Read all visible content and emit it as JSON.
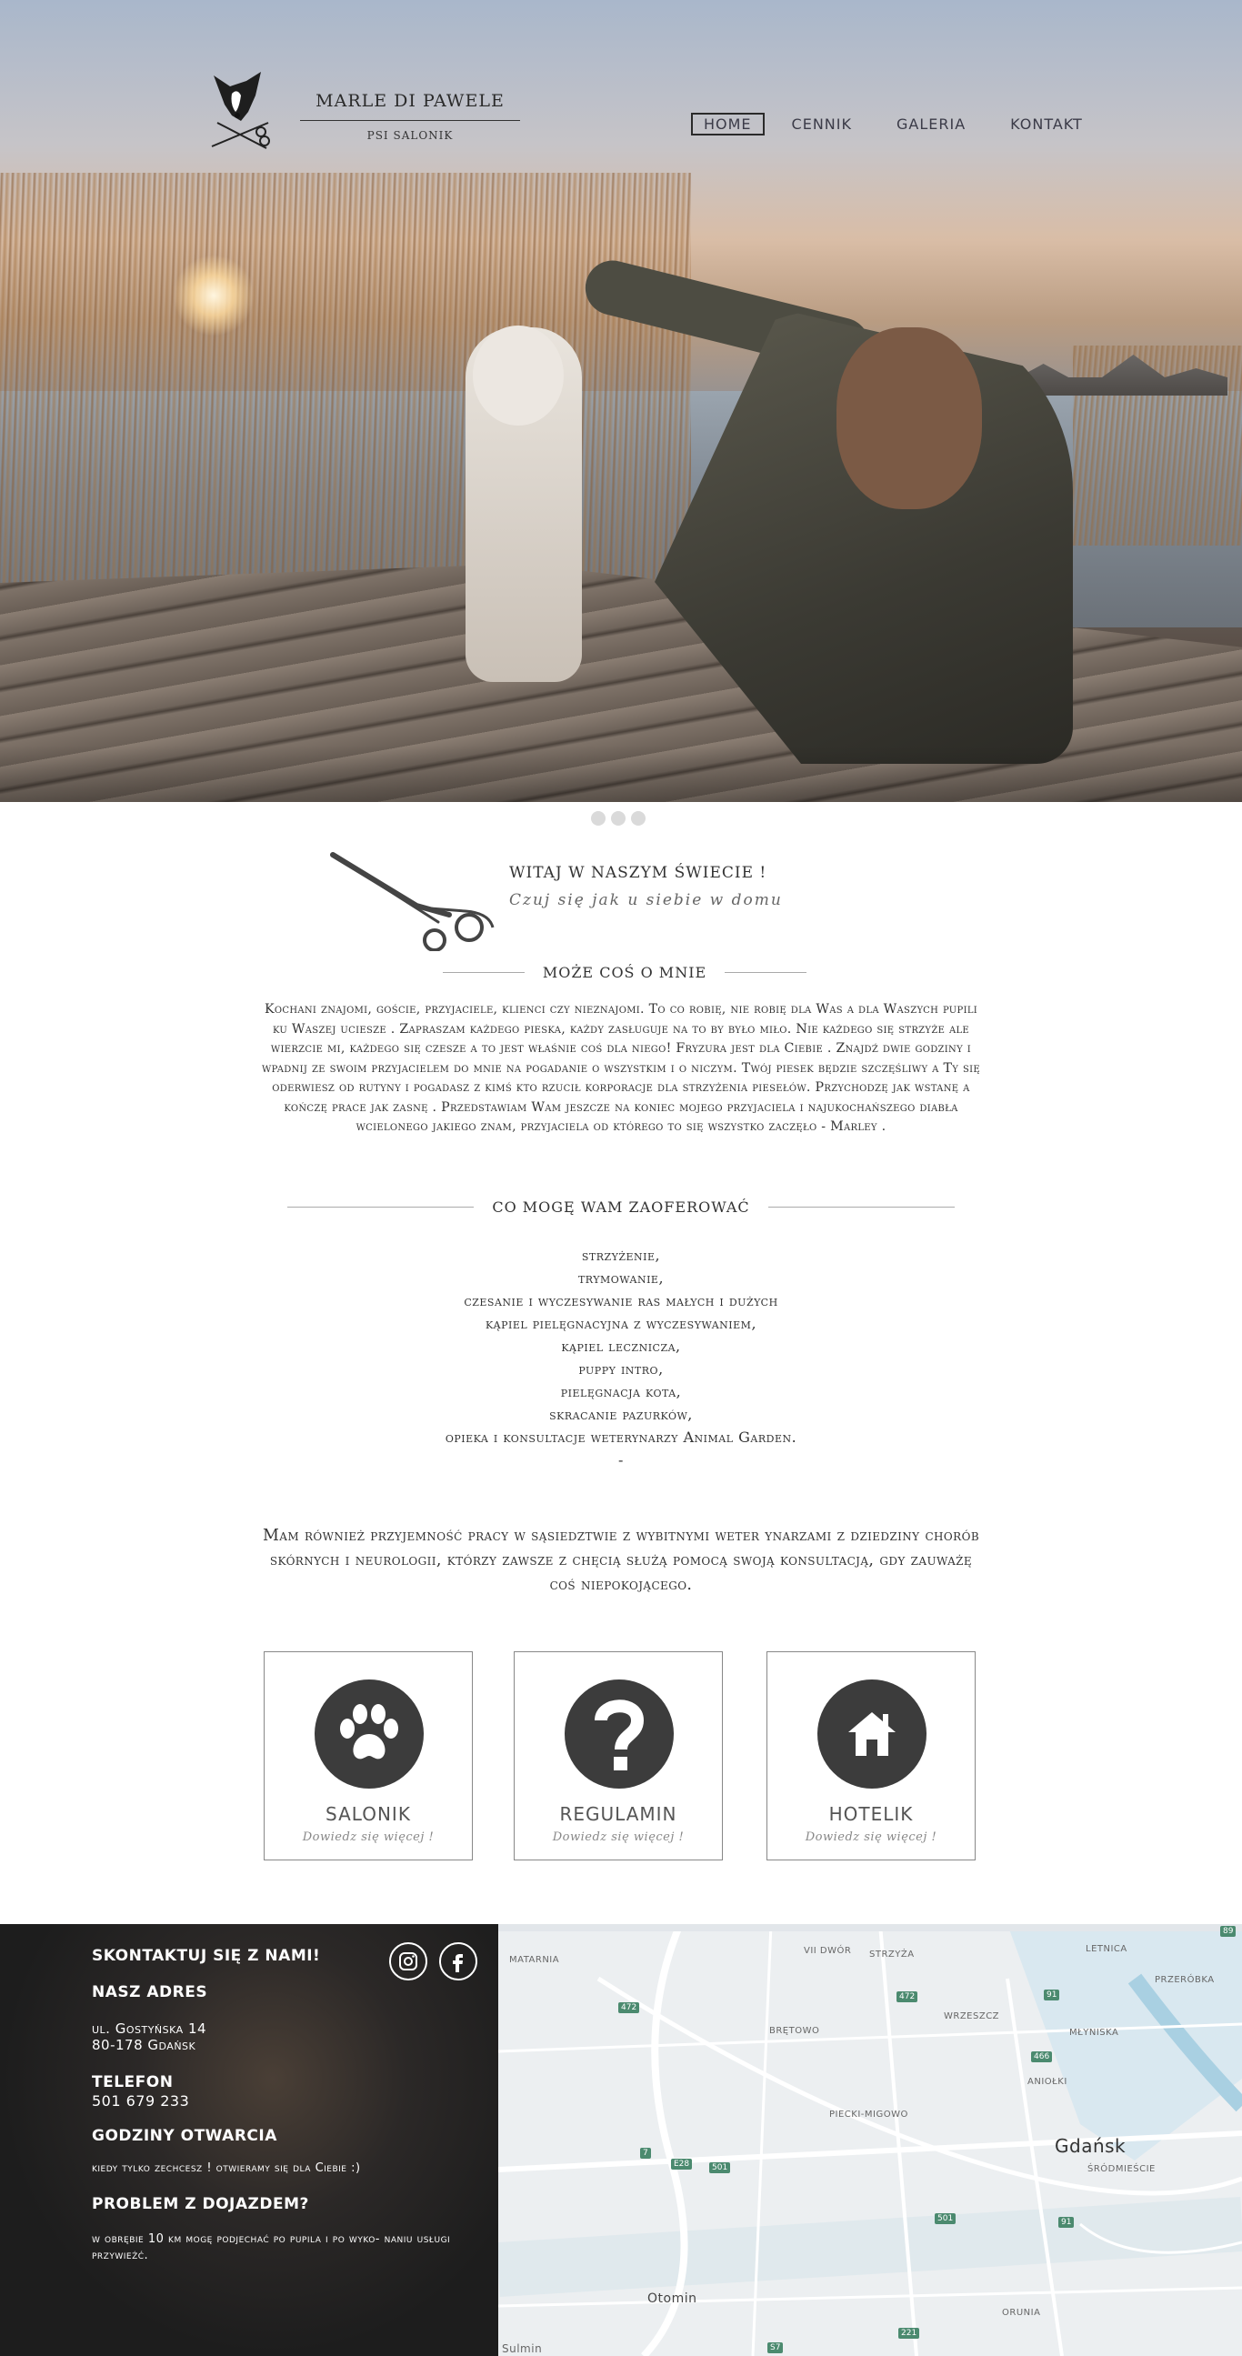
{
  "brand": {
    "name": "MARLE DI PAWELE",
    "subtitle": "PSI SALONIK"
  },
  "nav": {
    "items": [
      "HOME",
      "CENNIK",
      "GALERIA",
      "KONTAKT"
    ],
    "active": "HOME"
  },
  "welcome": {
    "title": "WITAJ W NASZYM ŚWIECIE !",
    "subtitle": "Czuj się jak u siebie w domu"
  },
  "about": {
    "heading": "MOŻE COŚ O MNIE",
    "text": "Kochani znajomi, goście, przyjaciele, klienci czy nieznajomi. To co robię, nie robię dla Was a dla Waszych pupili ku Waszej uciesze . Zapraszam każdego pieska, każdy zasługuje na to by było miło. Nie każdego się strzyże ale wierzcie mi, każdego się czesze a to jest właśnie coś dla niego! Fryzura jest dla Ciebie . Znajdź dwie godziny i wpadnij ze swoim przyjacielem do mnie na pogadanie o wszystkim i o niczym. Twój piesek będzie szczęśliwy a Ty się oderwiesz od rutyny i pogadasz z kimś kto rzucił korporacje dla strzyżenia piesełów. Przychodzę jak wstanę a kończę prace jak zasnę . Przedstawiam Wam jeszcze na koniec mojego przyjaciela i najukochańszego diabła wcielonego jakiego znam, przyjaciela od którego to się wszystko zaczęło - Marley ."
  },
  "offer": {
    "heading": "CO MOGĘ WAM ZAOFEROWAĆ",
    "items": [
      "strzyżenie,",
      "trymowanie,",
      "czesanie i wyczesywanie ras małych i dużych",
      "kąpiel pielęgnacyjna z wyczesywaniem,",
      "kąpiel lecznicza,",
      "puppy intro,",
      "pielęgnacja kota,",
      "skracanie pazurków,",
      "opieka i konsultacje weterynarzy Animal Garden.",
      "-"
    ]
  },
  "cooperation": "Mam również przyjemność pracy w sąsiedztwie z wybitnymi weter ynarzami z dziedziny chorób skórnych i  neurologii, którzy zawsze z chęcią służą pomocą swoją konsultacją, gdy zauważę coś niepokojącego.",
  "cards": [
    {
      "title": "SALONIK",
      "subtitle": "Dowiedz się więcej !",
      "icon": "paw-icon"
    },
    {
      "title": "REGULAMIN",
      "subtitle": "Dowiedz się więcej !",
      "icon": "question-icon"
    },
    {
      "title": "HOTELIK",
      "subtitle": "Dowiedz się więcej !",
      "icon": "house-icon"
    }
  ],
  "footer": {
    "contact_heading": "SKONTAKTUJ SIĘ Z NAMI!",
    "address_heading": "NASZ ADRES",
    "address_line1": "ul. Gostyńska 14",
    "address_line2": "80-178 Gdańsk",
    "phone_heading": "TELEFON",
    "phone": "501 679 233",
    "hours_heading": "GODZINY OTWARCIA",
    "hours": "kiedy tylko zechcesz ! otwieramy się dla Ciebie :)",
    "travel_heading": "PROBLEM Z DOJAZDEM?",
    "travel_text": "w obrębie 10 km mogę podjechać po pupila i po wyko- naniu usługi przywieźć."
  },
  "social": [
    "instagram-icon",
    "facebook-icon"
  ],
  "map": {
    "city": "Gdańsk",
    "labels": [
      "MATARNIA",
      "VII DWÓR",
      "STRZYŻA",
      "LETNICA",
      "PRZERÓBKA",
      "WRZESZCZ",
      "BRĘTOWO",
      "MŁYNISKA",
      "ANIOŁKI",
      "PIECKI-MIGOWO",
      "ŚRÓDMIEŚCIE",
      "Otomin",
      "ORUNIA",
      "Sulmin"
    ],
    "roads": [
      "472",
      "472",
      "91",
      "466",
      "7",
      "E28",
      "501",
      "501",
      "91",
      "221",
      "S7",
      "89"
    ]
  }
}
